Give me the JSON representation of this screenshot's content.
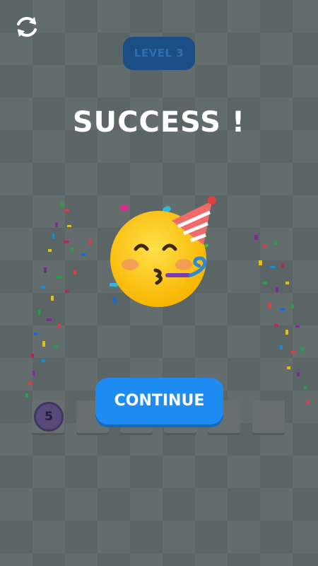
{
  "hud": {
    "level_label": "LEVEL 3",
    "refresh_icon": "refresh-icon"
  },
  "result": {
    "title": "SUCCESS !",
    "continue_label": "CONTINUE",
    "emoji": "party-face-emoji"
  },
  "board": {
    "token_value": "5",
    "slot_count": 6
  },
  "colors": {
    "background": "#5b6565",
    "button": "#1f8cf3",
    "badge": "#1c4e86",
    "title": "#ffffff"
  }
}
